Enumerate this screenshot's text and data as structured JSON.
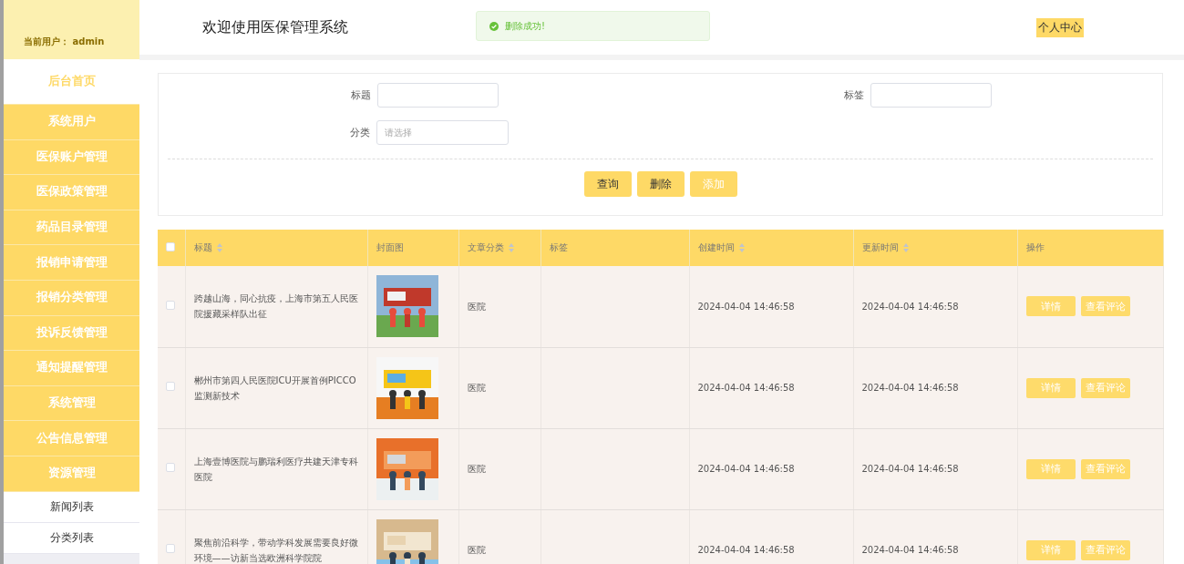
{
  "sidebar": {
    "current_user": "当前用户： admin",
    "items": [
      {
        "label": "后台首页",
        "selected": true
      },
      {
        "label": "系统用户",
        "selected": false
      },
      {
        "label": "医保账户管理",
        "selected": false
      },
      {
        "label": "医保政策管理",
        "selected": false
      },
      {
        "label": "药品目录管理",
        "selected": false
      },
      {
        "label": "报销申请管理",
        "selected": false
      },
      {
        "label": "报销分类管理",
        "selected": false
      },
      {
        "label": "投诉反馈管理",
        "selected": false
      },
      {
        "label": "通知提醒管理",
        "selected": false
      },
      {
        "label": "系统管理",
        "selected": false
      },
      {
        "label": "公告信息管理",
        "selected": false
      },
      {
        "label": "资源管理",
        "selected": false,
        "expanded": true,
        "children": [
          {
            "label": "新闻列表",
            "selected": false
          },
          {
            "label": "分类列表",
            "selected": false
          }
        ]
      }
    ]
  },
  "header": {
    "title": "欢迎使用医保管理系统",
    "toast": "删除成功!",
    "user_center": "个人中心"
  },
  "filters": {
    "fields": [
      {
        "label": "标题"
      },
      {
        "label": "标签"
      },
      {
        "label": "分类",
        "placeholder": "请选择"
      }
    ],
    "buttons": [
      {
        "label": "查询",
        "highlighted": false
      },
      {
        "label": "删除",
        "highlighted": false
      },
      {
        "label": "添加",
        "highlighted": true
      }
    ]
  },
  "table": {
    "all_checked": false,
    "columns": [
      {
        "label": "标题",
        "sortable": true
      },
      {
        "label": "封面图",
        "sortable": false
      },
      {
        "label": "文章分类",
        "sortable": true
      },
      {
        "label": "标签",
        "sortable": false
      },
      {
        "label": "创建时间",
        "sortable": true
      },
      {
        "label": "更新时间",
        "sortable": true
      },
      {
        "label": "操作",
        "sortable": false
      }
    ],
    "rows": [
      {
        "checked": false,
        "title": "跨越山海，同心抗疫，上海市第五人民医院援藏采样队出征",
        "cover": {
          "kind": "picture"
        },
        "category": "医院",
        "tag": "",
        "created": "2024-04-04 14:46:58",
        "updated": "2024-04-04 14:46:58",
        "actions": [
          "详情",
          "查看评论"
        ]
      },
      {
        "checked": false,
        "title": "郴州市第四人民医院ICU开展首例PICCO监测新技术",
        "cover": {
          "kind": "picture"
        },
        "category": "医院",
        "tag": "",
        "created": "2024-04-04 14:46:58",
        "updated": "2024-04-04 14:46:58",
        "actions": [
          "详情",
          "查看评论"
        ]
      },
      {
        "checked": false,
        "title": "上海壹博医院与鹏瑞利医疗共建天津专科医院",
        "cover": {
          "kind": "picture"
        },
        "category": "医院",
        "tag": "",
        "created": "2024-04-04 14:46:58",
        "updated": "2024-04-04 14:46:58",
        "actions": [
          "详情",
          "查看评论"
        ]
      },
      {
        "checked": false,
        "title": "聚焦前沿科学，带动学科发展需要良好微环境——访新当选欧洲科学院院",
        "cover": {
          "kind": "picture"
        },
        "category": "医院",
        "tag": "",
        "created": "2024-04-04 14:46:58",
        "updated": "2024-04-04 14:46:58",
        "actions": [
          "详情",
          "查看评论"
        ]
      }
    ]
  }
}
